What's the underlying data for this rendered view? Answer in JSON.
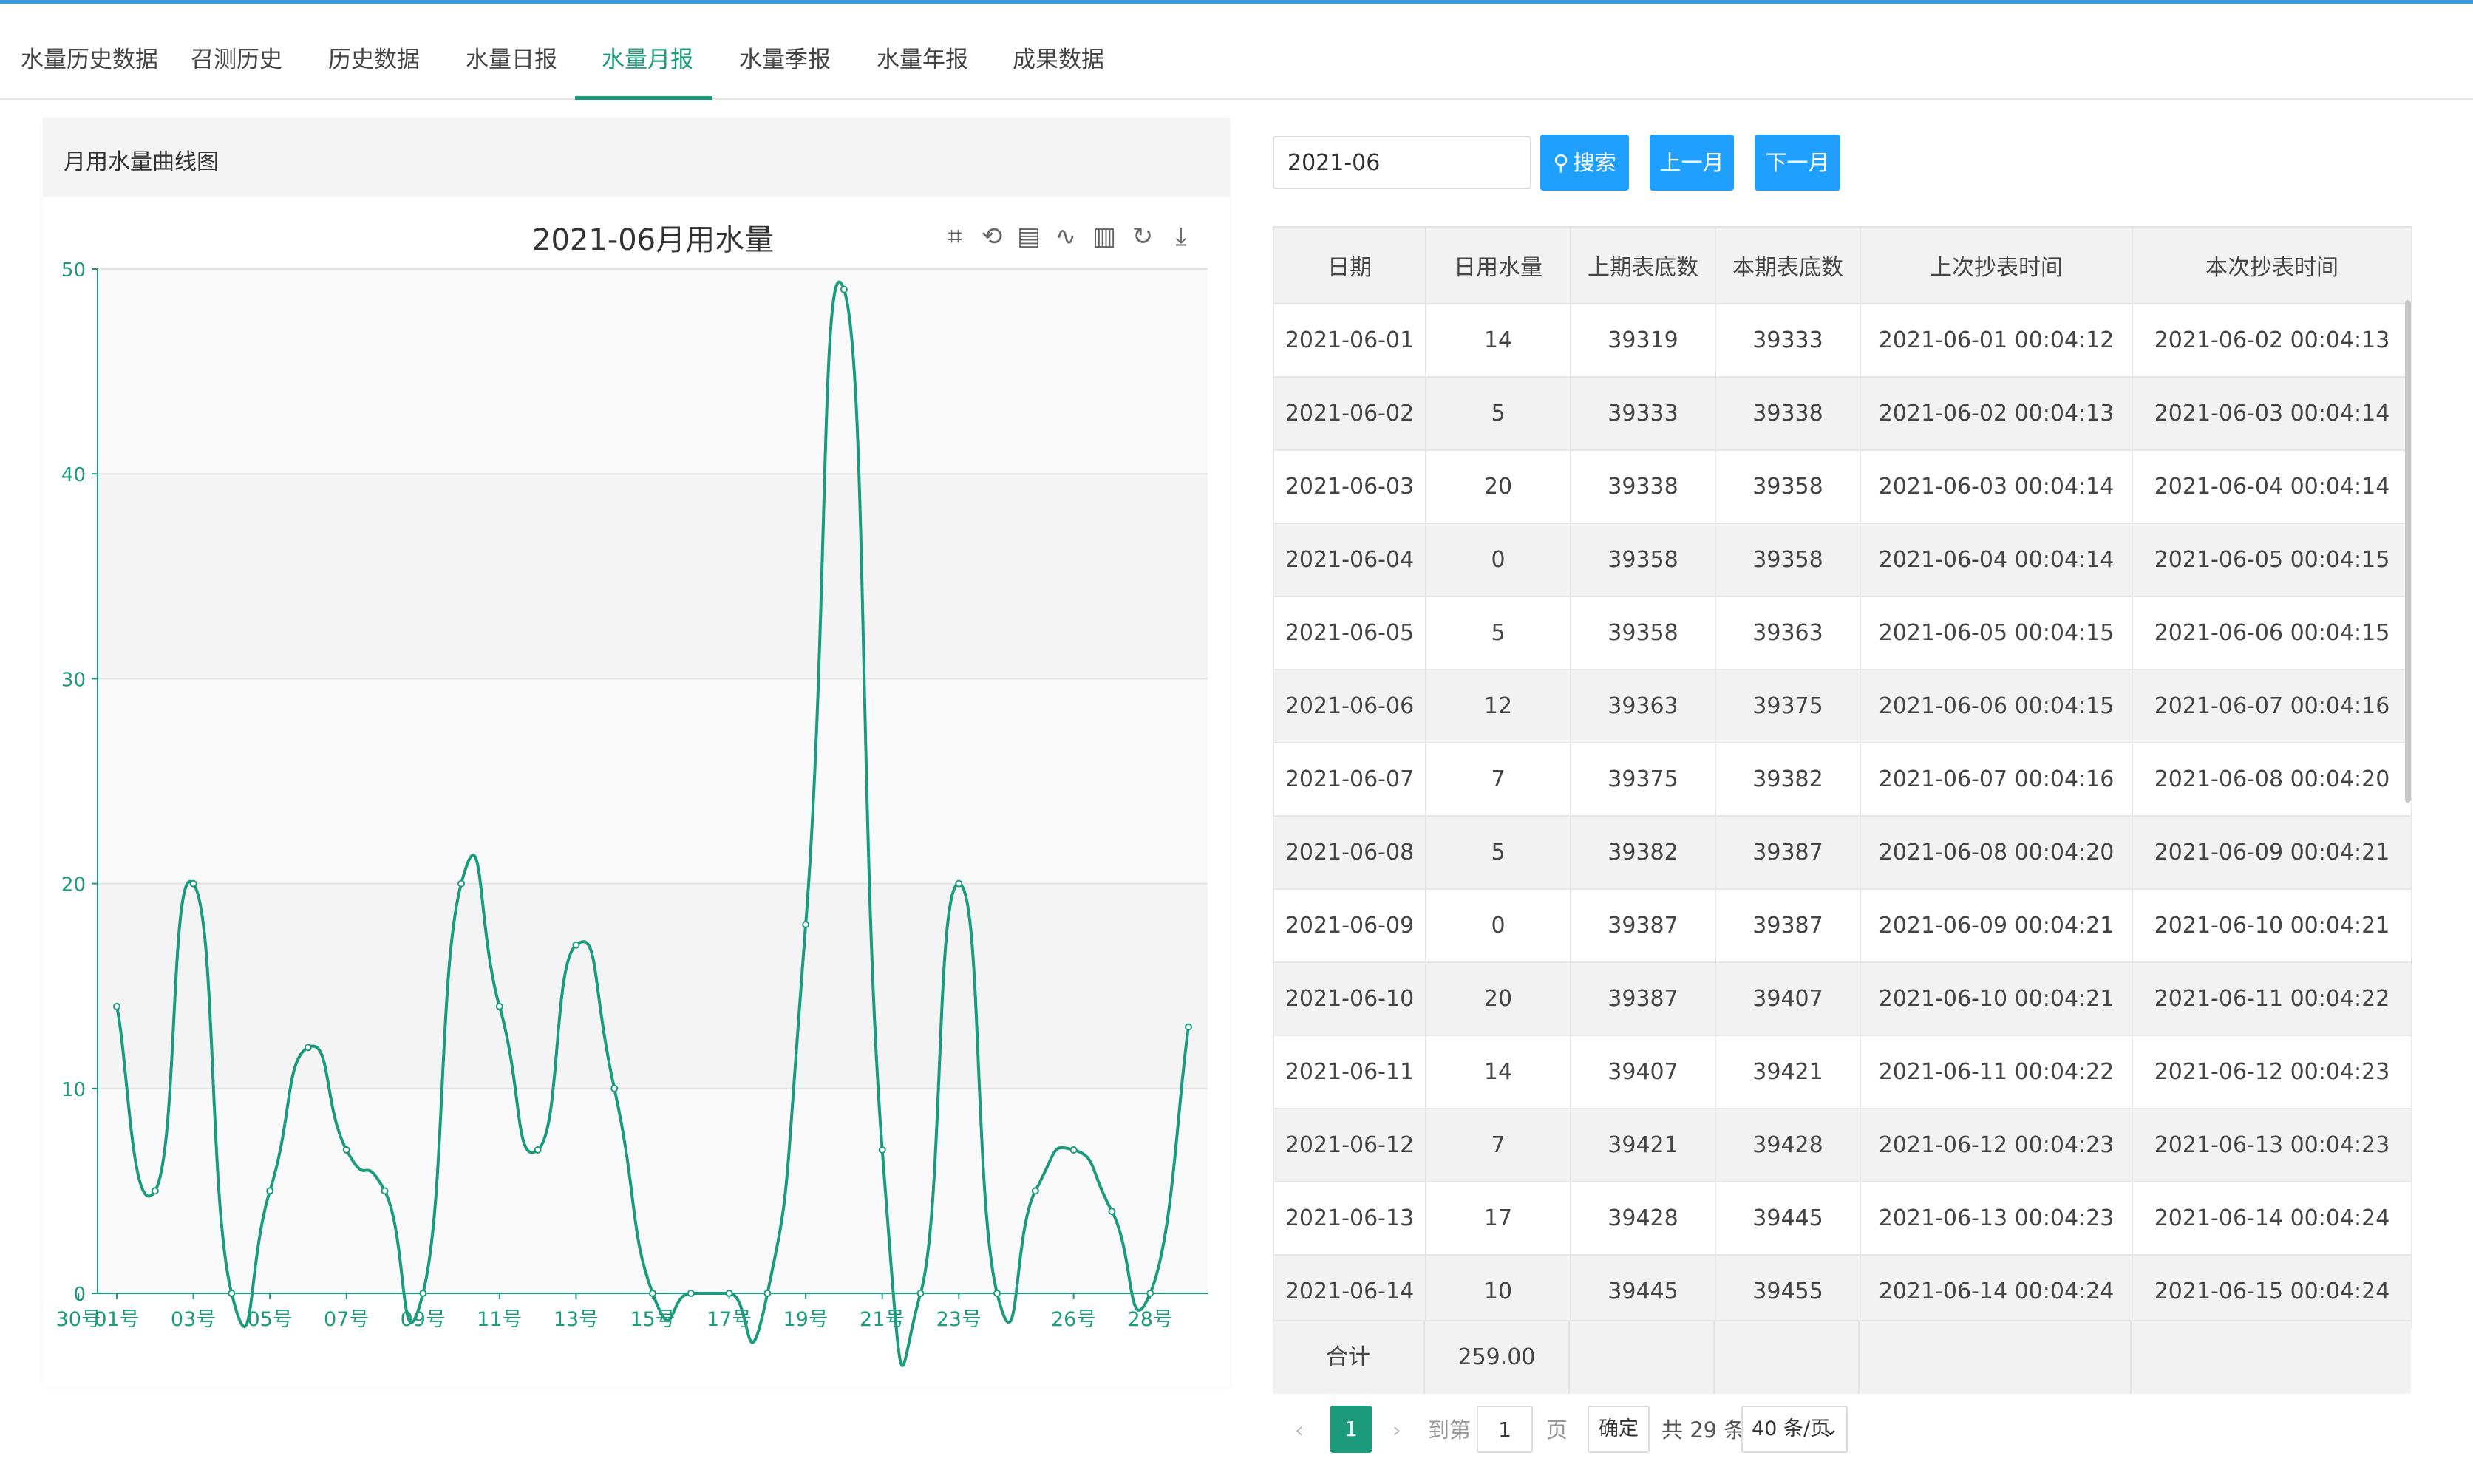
{
  "tabs": [
    {
      "label": "水量历史数据",
      "active": false
    },
    {
      "label": "召测历史",
      "active": false
    },
    {
      "label": "历史数据",
      "active": false
    },
    {
      "label": "水量日报",
      "active": false
    },
    {
      "label": "水量月报",
      "active": true
    },
    {
      "label": "水量季报",
      "active": false
    },
    {
      "label": "水量年报",
      "active": false
    },
    {
      "label": "成果数据",
      "active": false
    }
  ],
  "left_panel": {
    "header": "月用水量曲线图"
  },
  "toolbar_icons": [
    "zoom-icon",
    "zoom-reset-icon",
    "data-view-icon",
    "line-chart-icon",
    "bar-chart-icon",
    "restore-icon",
    "download-icon"
  ],
  "chart_data": {
    "type": "line",
    "title": "2021-06月用水量",
    "smooth": true,
    "color": "#1b9b7c",
    "x_tick_labels": [
      "01号",
      "03号",
      "05号",
      "07号",
      "09号",
      "11号",
      "13号",
      "15号",
      "17号",
      "19号",
      "21号",
      "23号",
      "26号",
      "28号",
      "30号"
    ],
    "x": [
      "01号",
      "02号",
      "03号",
      "04号",
      "05号",
      "06号",
      "07号",
      "08号",
      "09号",
      "10号",
      "11号",
      "12号",
      "13号",
      "14号",
      "15号",
      "16号",
      "17号",
      "18号",
      "19号",
      "20号",
      "21号",
      "22号",
      "23号",
      "24号",
      "25号",
      "26号",
      "27号",
      "28号",
      "29号"
    ],
    "values": [
      14,
      5,
      20,
      0,
      5,
      12,
      7,
      5,
      0,
      20,
      14,
      7,
      17,
      10,
      0,
      0,
      0,
      0,
      18,
      49,
      7,
      0,
      20,
      0,
      5,
      7,
      4,
      0,
      13
    ],
    "ylim": [
      0,
      50
    ],
    "yticks": [
      0,
      10,
      20,
      30,
      40,
      50
    ],
    "grid": true,
    "banded": true
  },
  "search": {
    "month_value": "2021-06",
    "search_label": "搜索",
    "prev_label": "上一月",
    "next_label": "下一月"
  },
  "table": {
    "columns": [
      "日期",
      "日用水量",
      "上期表底数",
      "本期表底数",
      "上次抄表时间",
      "本次抄表时间"
    ],
    "rows": [
      [
        "2021-06-01",
        "14",
        "39319",
        "39333",
        "2021-06-01 00:04:12",
        "2021-06-02 00:04:13"
      ],
      [
        "2021-06-02",
        "5",
        "39333",
        "39338",
        "2021-06-02 00:04:13",
        "2021-06-03 00:04:14"
      ],
      [
        "2021-06-03",
        "20",
        "39338",
        "39358",
        "2021-06-03 00:04:14",
        "2021-06-04 00:04:14"
      ],
      [
        "2021-06-04",
        "0",
        "39358",
        "39358",
        "2021-06-04 00:04:14",
        "2021-06-05 00:04:15"
      ],
      [
        "2021-06-05",
        "5",
        "39358",
        "39363",
        "2021-06-05 00:04:15",
        "2021-06-06 00:04:15"
      ],
      [
        "2021-06-06",
        "12",
        "39363",
        "39375",
        "2021-06-06 00:04:15",
        "2021-06-07 00:04:16"
      ],
      [
        "2021-06-07",
        "7",
        "39375",
        "39382",
        "2021-06-07 00:04:16",
        "2021-06-08 00:04:20"
      ],
      [
        "2021-06-08",
        "5",
        "39382",
        "39387",
        "2021-06-08 00:04:20",
        "2021-06-09 00:04:21"
      ],
      [
        "2021-06-09",
        "0",
        "39387",
        "39387",
        "2021-06-09 00:04:21",
        "2021-06-10 00:04:21"
      ],
      [
        "2021-06-10",
        "20",
        "39387",
        "39407",
        "2021-06-10 00:04:21",
        "2021-06-11 00:04:22"
      ],
      [
        "2021-06-11",
        "14",
        "39407",
        "39421",
        "2021-06-11 00:04:22",
        "2021-06-12 00:04:23"
      ],
      [
        "2021-06-12",
        "7",
        "39421",
        "39428",
        "2021-06-12 00:04:23",
        "2021-06-13 00:04:23"
      ],
      [
        "2021-06-13",
        "17",
        "39428",
        "39445",
        "2021-06-13 00:04:23",
        "2021-06-14 00:04:24"
      ],
      [
        "2021-06-14",
        "10",
        "39445",
        "39455",
        "2021-06-14 00:04:24",
        "2021-06-15 00:04:24"
      ]
    ],
    "summary": {
      "label": "合计",
      "value": "259.00"
    }
  },
  "pagination": {
    "current_page": "1",
    "goto_label": "到第",
    "goto_value": "1",
    "page_unit": "页",
    "confirm_label": "确定",
    "total_label": "共 29 条",
    "page_size": "40 条/页",
    "prev_icon": "chevron-left-icon",
    "next_icon": "chevron-right-icon"
  }
}
